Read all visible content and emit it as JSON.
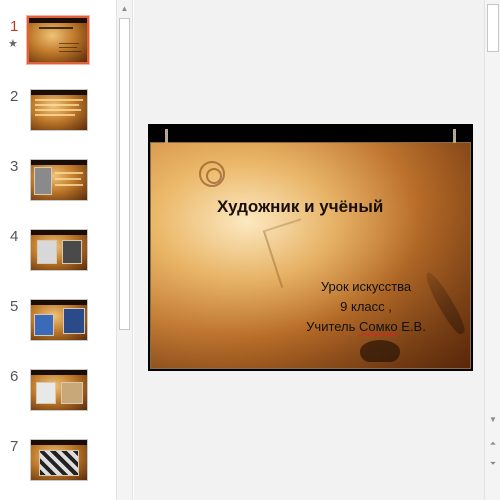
{
  "thumbnails": [
    {
      "number": "1",
      "has_star": true,
      "selected": true,
      "title": "Художник и учёный"
    },
    {
      "number": "2"
    },
    {
      "number": "3"
    },
    {
      "number": "4"
    },
    {
      "number": "5"
    },
    {
      "number": "6"
    },
    {
      "number": "7"
    }
  ],
  "slide": {
    "title": "Художник и учёный",
    "line1": "Урок искусства",
    "line2": "9 класс ,",
    "line3_prefix": "Учитель ",
    "line3_misspelled": "Сомко",
    "line3_suffix": " Е.В."
  },
  "icons": {
    "star": "star-icon",
    "scroll_up": "scroll-up-arrow-icon",
    "scroll_down": "scroll-down-arrow-icon",
    "prev_slide": "previous-slide-icon",
    "next_slide": "next-slide-icon"
  },
  "colors": {
    "selection_border": "#e0603a",
    "active_number": "#c0392b",
    "spell_check": "#e02020"
  }
}
